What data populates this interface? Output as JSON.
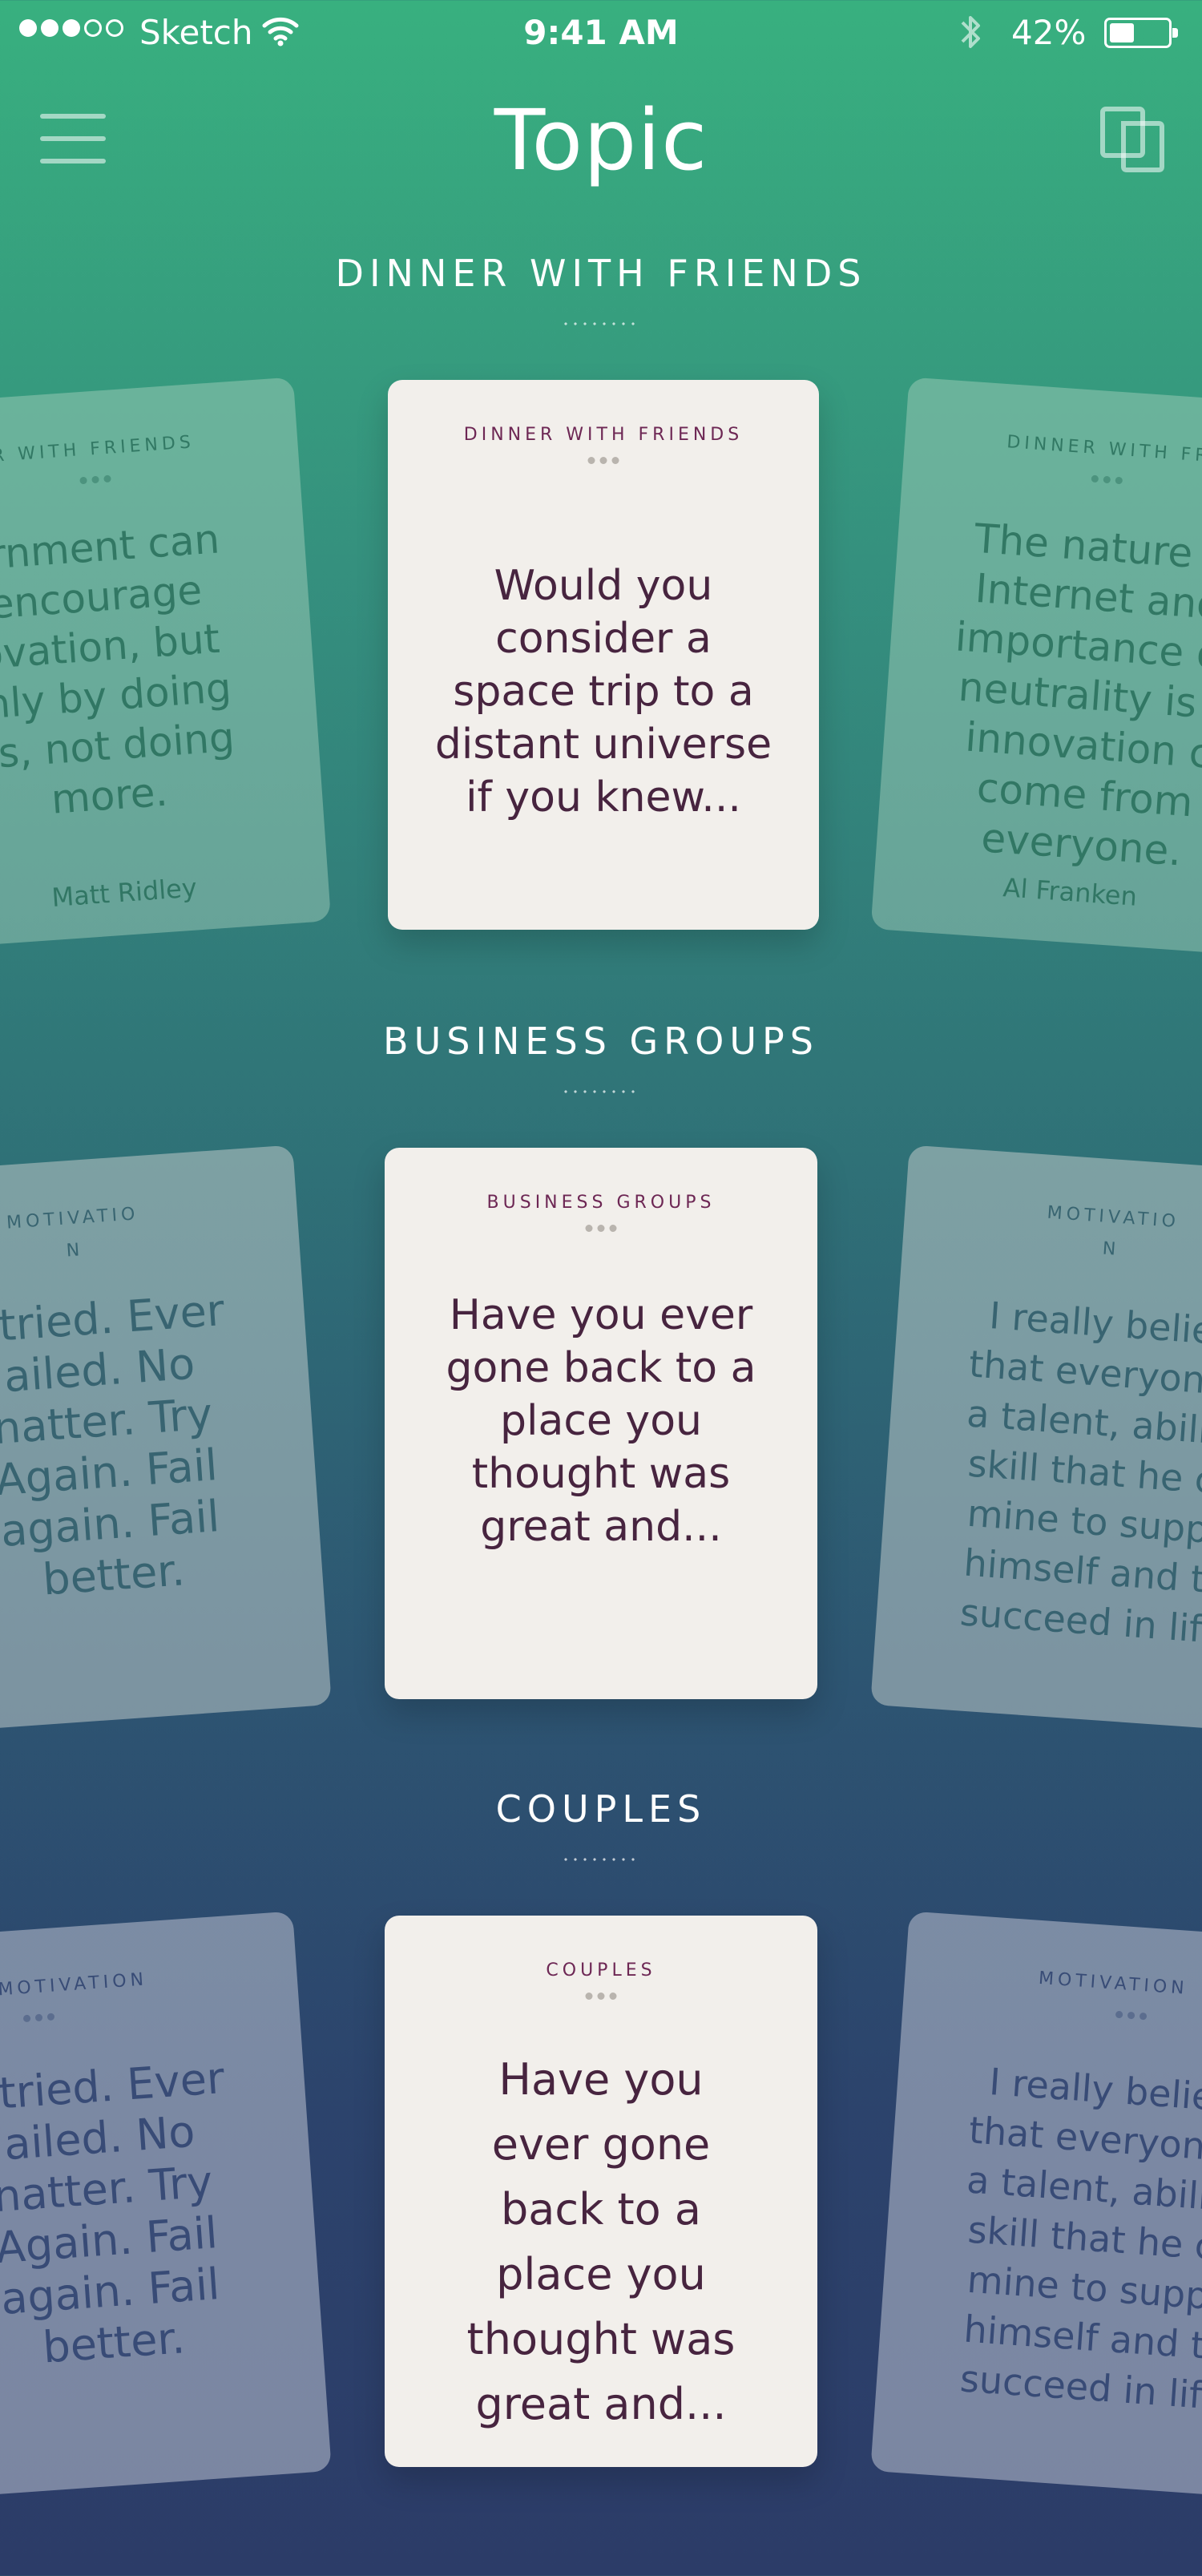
{
  "status_bar": {
    "carrier": "Sketch",
    "time": "9:41 AM",
    "battery": "42%",
    "battery_level": 0.42,
    "signal_bars": 3,
    "signal_total": 5
  },
  "nav": {
    "title": "Topic",
    "menu_icon": "hamburger-menu-icon",
    "right_icon": "cards-stack-icon"
  },
  "colors": {
    "card_bg": "#f2efeb",
    "card_label": "#6d2754",
    "card_text": "#47243f",
    "gradient_top": "#38b07f",
    "gradient_bottom": "#2c3c68"
  },
  "sections": [
    {
      "title": "DINNER WITH FRIENDS",
      "card": {
        "label": "DINNER WITH FRIENDS",
        "lines": [
          "Would you",
          "consider a",
          "space trip to a",
          "distant universe",
          "if you knew..."
        ]
      },
      "left_card": {
        "label": "R WITH FRIENDS",
        "lines": [
          "ernment can",
          "encourage",
          "ovation, but",
          "inly by doing",
          "ss, not doing",
          "more."
        ],
        "author": "Matt Ridley"
      },
      "right_card": {
        "label": "DINNER WITH FR",
        "lines": [
          "The nature o",
          "Internet and",
          "importance of",
          "neutrality is t",
          "innovation c",
          "come from",
          "everyone."
        ],
        "author": "Al Franken"
      }
    },
    {
      "title": "BUSINESS GROUPS",
      "card": {
        "label": "BUSINESS GROUPS",
        "lines": [
          "Have you ever",
          "gone back to a",
          "place you",
          "thought was",
          "great and..."
        ]
      },
      "left_card": {
        "label": "MOTIVATIO",
        "label2": "N",
        "lines": [
          "r tried. Ever",
          "ailed. No",
          "natter. Try",
          "Again. Fail",
          "again. Fail",
          "better."
        ]
      },
      "right_card": {
        "label": "MOTIVATIO",
        "label2": "N",
        "lines": [
          "I really belie",
          "that everyone",
          "a talent, abilit",
          "skill that he c",
          "mine to supp",
          "himself and t",
          "succeed in lif"
        ]
      }
    },
    {
      "title": "COUPLES",
      "card": {
        "label": "COUPLES",
        "lines": [
          "Have you",
          "ever gone",
          "back to a",
          "place you",
          "thought was",
          "great and..."
        ]
      },
      "left_card": {
        "label": "MOTIVATION",
        "lines": [
          "r tried. Ever",
          "ailed. No",
          "natter. Try",
          "Again. Fail",
          "again. Fail",
          "better."
        ]
      },
      "right_card": {
        "label": "MOTIVATION",
        "lines": [
          "I really belie",
          "that everyone",
          "a talent, abilit",
          "skill that he c",
          "mine to supp",
          "himself and t",
          "succeed in lif"
        ]
      }
    }
  ]
}
